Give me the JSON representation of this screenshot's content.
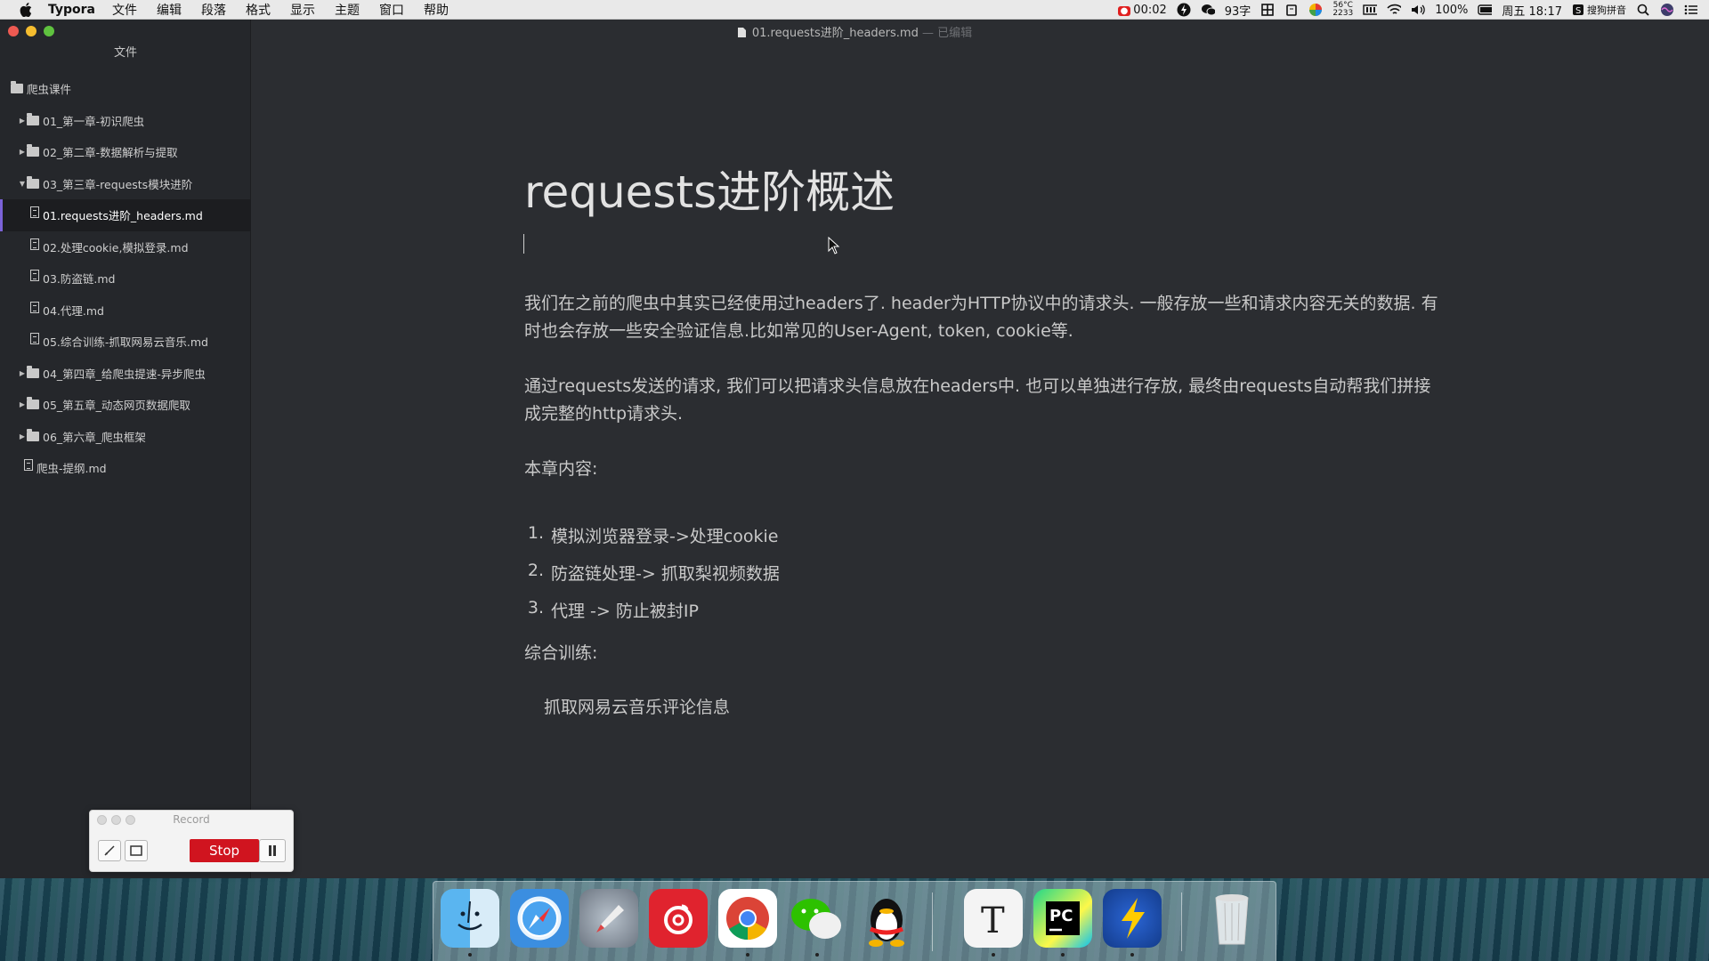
{
  "menubar": {
    "app_name": "Typora",
    "menus": [
      "文件",
      "编辑",
      "段落",
      "格式",
      "显示",
      "主题",
      "窗口",
      "帮助"
    ],
    "status": {
      "record_time": "00:02",
      "word_count": "93字",
      "temp_top": "56°C",
      "temp_bottom": "2233",
      "battery": "100%",
      "clock": "周五 18:17",
      "input_method": "搜狗拼音"
    }
  },
  "window": {
    "title": "01.requests进阶_headers.md",
    "title_suffix": "— 已编辑"
  },
  "sidebar": {
    "header": "文件",
    "items": [
      {
        "label": "爬虫课件",
        "type": "folder",
        "level": 0,
        "open": true
      },
      {
        "label": "01_第一章-初识爬虫",
        "type": "folder",
        "level": 1,
        "open": false
      },
      {
        "label": "02_第二章-数据解析与提取",
        "type": "folder",
        "level": 1,
        "open": false
      },
      {
        "label": "03_第三章-requests模块进阶",
        "type": "folder",
        "level": 1,
        "open": true
      },
      {
        "label": "01.requests进阶_headers.md",
        "type": "file",
        "level": 2,
        "active": true
      },
      {
        "label": "02.处理cookie,模拟登录.md",
        "type": "file",
        "level": 2
      },
      {
        "label": "03.防盗链.md",
        "type": "file",
        "level": 2
      },
      {
        "label": "04.代理.md",
        "type": "file",
        "level": 2
      },
      {
        "label": "05.综合训练-抓取网易云音乐.md",
        "type": "file",
        "level": 2
      },
      {
        "label": "04_第四章_给爬虫提速-异步爬虫",
        "type": "folder",
        "level": 1,
        "open": false
      },
      {
        "label": "05_第五章_动态网页数据爬取",
        "type": "folder",
        "level": 1,
        "open": false
      },
      {
        "label": "06_第六章_爬虫框架",
        "type": "folder",
        "level": 1,
        "open": false
      },
      {
        "label": "爬虫-提纲.md",
        "type": "file",
        "level": 1
      }
    ]
  },
  "document": {
    "heading": "requests进阶概述",
    "p1": "我们在之前的爬虫中其实已经使用过headers了. header为HTTP协议中的请求头. 一般存放一些和请求内容无关的数据. 有时也会存放一些安全验证信息.比如常见的User-Agent, token, cookie等.",
    "p2": "通过requests发送的请求, 我们可以把请求头信息放在headers中. 也可以单独进行存放, 最终由requests自动帮我们拼接成完整的http请求头.",
    "p3": "本章内容:",
    "list": [
      {
        "num": "1.",
        "text": "模拟浏览器登录->处理cookie"
      },
      {
        "num": "2.",
        "text": "防盗链处理-> 抓取梨视频数据"
      },
      {
        "num": "3.",
        "text": "代理 -> 防止被封IP"
      }
    ],
    "p4": "综合训练:",
    "p5": "抓取网易云音乐评论信息"
  },
  "record_widget": {
    "title": "Record",
    "stop_label": "Stop"
  },
  "dock": {
    "apps": [
      "finder-icon",
      "safari-icon",
      "launchpad-icon",
      "netease-music-icon",
      "chrome-icon",
      "wechat-icon",
      "qq-icon",
      "typora-icon",
      "pycharm-icon",
      "dashing-icon",
      "trash-icon"
    ]
  },
  "colors": {
    "accent": "#7b62d8",
    "stop": "#d0141f",
    "editor_bg": "#2b2d31",
    "sidebar_bg": "#25272b"
  }
}
